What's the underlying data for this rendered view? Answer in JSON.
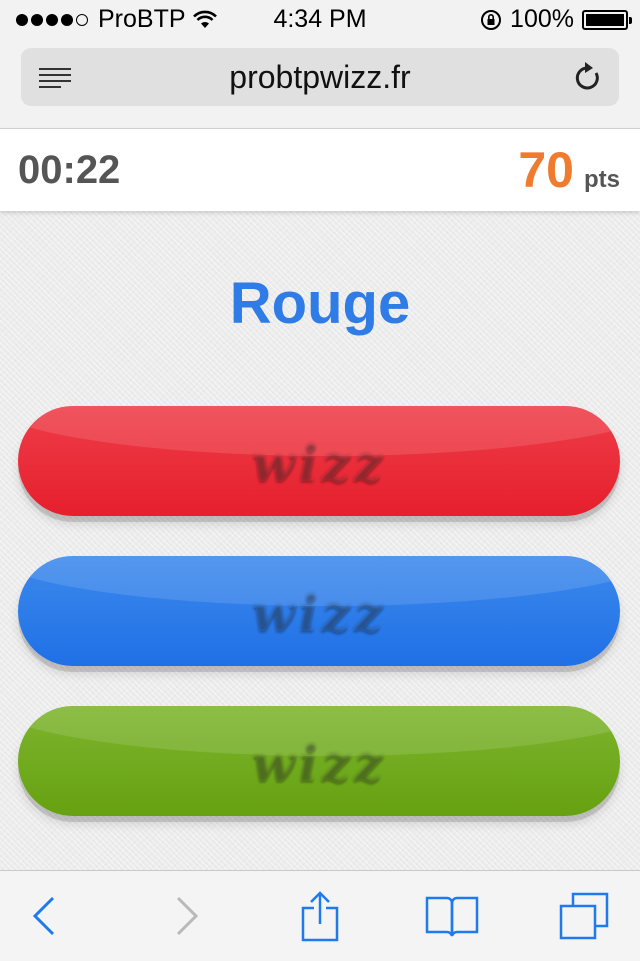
{
  "status_bar": {
    "carrier": "ProBTP",
    "time": "4:34 PM",
    "battery": "100%"
  },
  "browser": {
    "url": "probtpwizz.fr"
  },
  "game": {
    "timer": "00:22",
    "score": "70",
    "score_unit": "pts",
    "word": "Rouge",
    "answers": [
      {
        "color": "red",
        "hex": "#e8202d",
        "watermark": "wizz"
      },
      {
        "color": "blue",
        "hex": "#2477e8",
        "watermark": "wizz"
      },
      {
        "color": "green",
        "hex": "#6fa81a",
        "watermark": "wizz"
      }
    ],
    "accent_colors": {
      "word": "#2f7ce6",
      "score": "#f07a2e"
    }
  },
  "toolbar": {
    "icons": [
      "back-icon",
      "forward-icon",
      "share-icon",
      "bookmarks-icon",
      "tabs-icon"
    ]
  }
}
